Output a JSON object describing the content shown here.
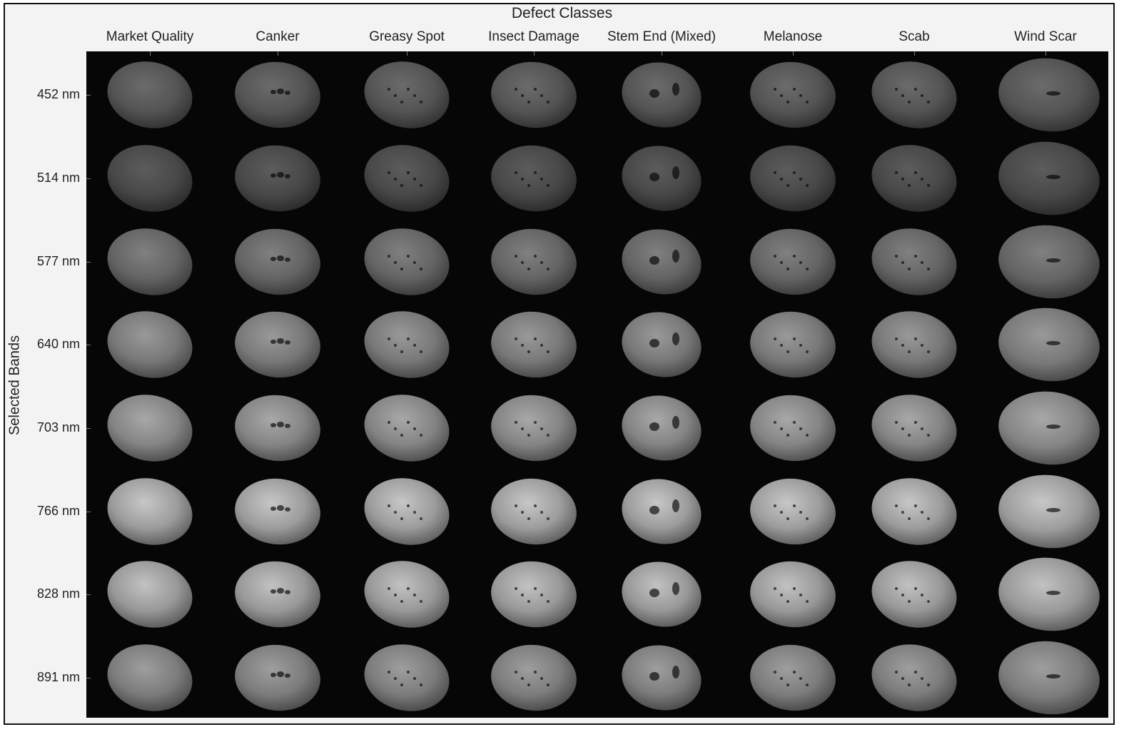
{
  "super_title": "Defect Classes",
  "y_title": "Selected Bands",
  "columns": [
    {
      "label": "Market Quality",
      "size": "medium"
    },
    {
      "label": "Canker",
      "size": "medium"
    },
    {
      "label": "Greasy Spot",
      "size": "medium"
    },
    {
      "label": "Insect Damage",
      "size": "medium"
    },
    {
      "label": "Stem End (Mixed)",
      "size": "small"
    },
    {
      "label": "Melanose",
      "size": "medium"
    },
    {
      "label": "Scab",
      "size": "medium"
    },
    {
      "label": "Wind Scar",
      "size": "large"
    }
  ],
  "rows": [
    {
      "label": "452 nm",
      "brightness": 0.42
    },
    {
      "label": "514 nm",
      "brightness": 0.36
    },
    {
      "label": "577 nm",
      "brightness": 0.5
    },
    {
      "label": "640 nm",
      "brightness": 0.6
    },
    {
      "label": "703 nm",
      "brightness": 0.66
    },
    {
      "label": "766 nm",
      "brightness": 0.78
    },
    {
      "label": "828 nm",
      "brightness": 0.76
    },
    {
      "label": "891 nm",
      "brightness": 0.62
    }
  ],
  "colors": {
    "panel_bg": "#060606",
    "frame": "#111111",
    "figure_bg": "#f3f3f3"
  }
}
